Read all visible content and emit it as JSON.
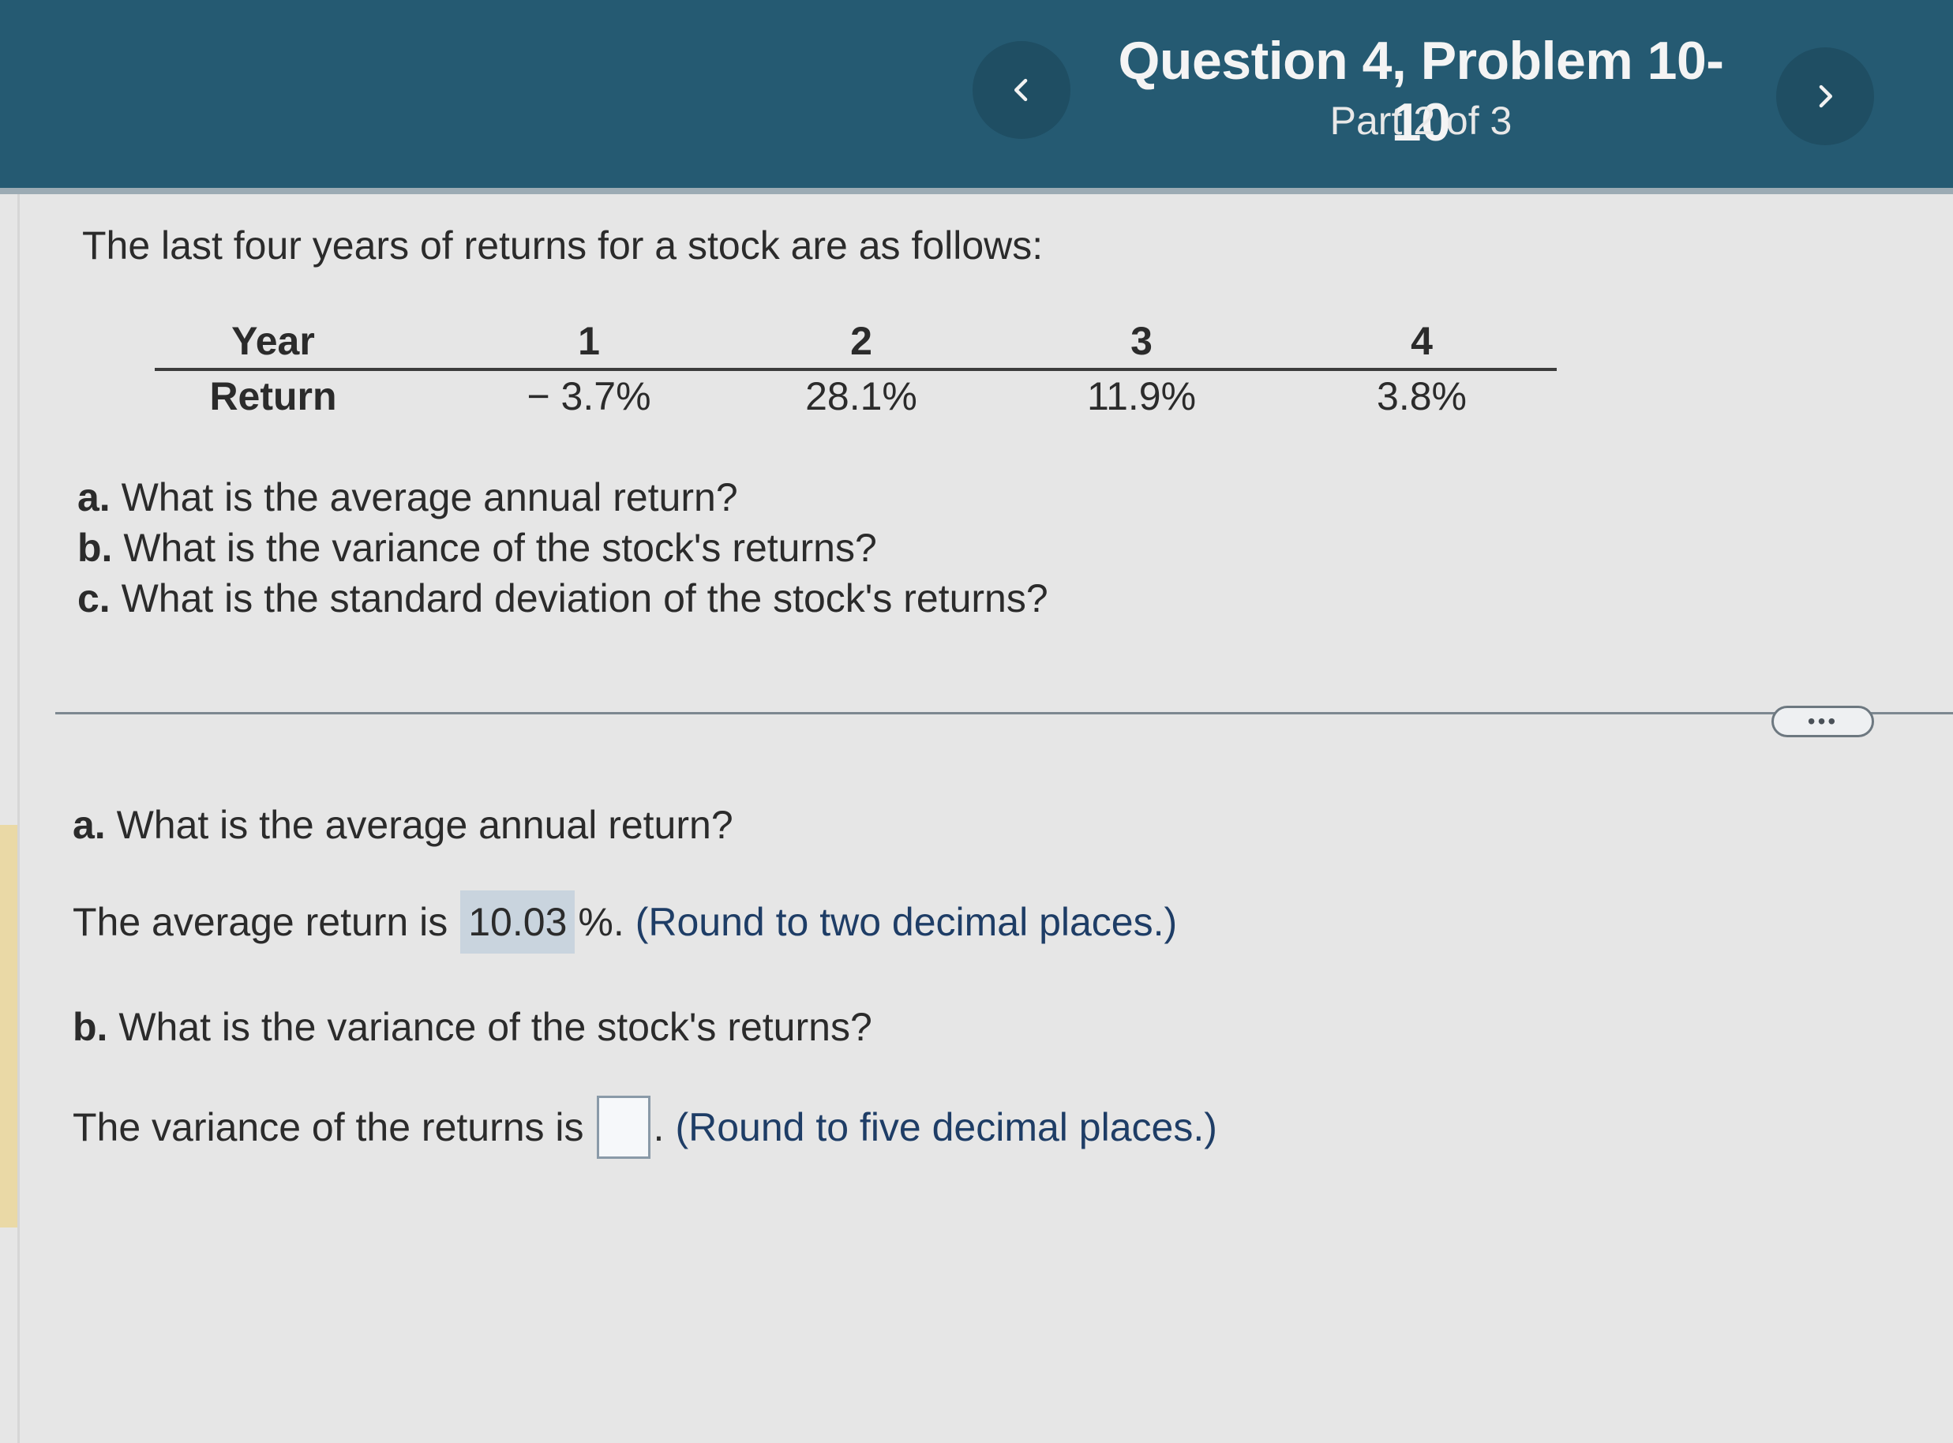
{
  "header": {
    "title": "Question 4, Problem 10-10",
    "subtitle": "Part 2 of 3",
    "prev_glyph": "<",
    "next_glyph": ">"
  },
  "intro": "The last four years of returns for a stock are as follows:",
  "table": {
    "row_labels": [
      "Year",
      "Return"
    ],
    "years": [
      "1",
      "2",
      "3",
      "4"
    ],
    "returns": [
      "− 3.7%",
      "28.1%",
      "11.9%",
      "3.8%"
    ]
  },
  "questions": [
    {
      "letter": "a.",
      "text": " What is the average annual return?"
    },
    {
      "letter": "b.",
      "text": " What is the variance of the stock's returns?"
    },
    {
      "letter": "c.",
      "text": " What is the standard deviation of the stock's returns?"
    }
  ],
  "more_button": "•••",
  "part_a": {
    "letter": "a.",
    "question": " What is the average annual return?",
    "prefix": "The average return is",
    "value": "10.03",
    "suffix": "%.",
    "hint": "(Round to two decimal places.)"
  },
  "part_b": {
    "letter": "b.",
    "question": " What is the variance of the stock's returns?",
    "prefix": "The variance of the returns is",
    "value": "",
    "suffix": ".",
    "hint": "(Round to five decimal places.)"
  },
  "colors": {
    "header": "#255a72",
    "answer_highlight": "#c9d4de",
    "hint_text": "#1e3d66"
  }
}
